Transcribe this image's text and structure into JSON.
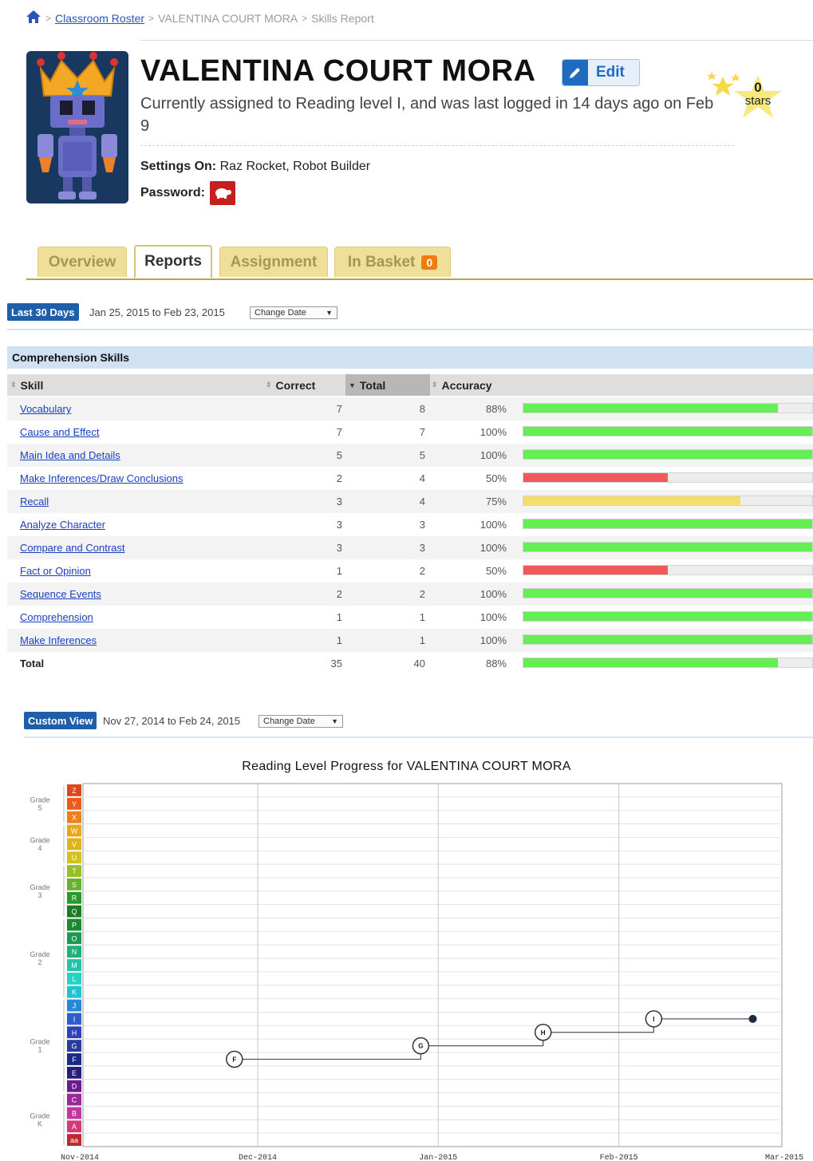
{
  "breadcrumb": {
    "home_icon": "home-icon",
    "items": [
      "Classroom Roster",
      "VALENTINA COURT MORA",
      "Skills Report"
    ],
    "separator": ">"
  },
  "student": {
    "name": "VALENTINA COURT MORA",
    "edit_label": "Edit",
    "status": "Currently assigned to Reading level I, and was last logged in 14 days ago on Feb 9",
    "settings_label": "Settings On:",
    "settings_value": "Raz Rocket, Robot Builder",
    "password_label": "Password:",
    "password_icon": "turtle-icon",
    "stars_count": "0",
    "stars_label": "stars"
  },
  "tabs": [
    {
      "label": "Overview",
      "active": false
    },
    {
      "label": "Reports",
      "active": true
    },
    {
      "label": "Assignment",
      "active": false
    },
    {
      "label": "In Basket",
      "active": false,
      "badge": "0"
    }
  ],
  "skills_range": {
    "badge": "Last 30 Days",
    "dates": "Jan 25, 2015 to Feb 23, 2015",
    "change_label": "Change Date"
  },
  "skills_table": {
    "title": "Comprehension Skills",
    "headers": [
      "Skill",
      "Correct",
      "Total",
      "Accuracy"
    ],
    "sorted_column": "Total",
    "rows": [
      {
        "skill": "Vocabulary",
        "correct": "7",
        "total": "8",
        "accuracy": "88%",
        "pct": 0.88,
        "color": "#66ee55"
      },
      {
        "skill": "Cause and Effect",
        "correct": "7",
        "total": "7",
        "accuracy": "100%",
        "pct": 1.0,
        "color": "#66ee55"
      },
      {
        "skill": "Main Idea and Details",
        "correct": "5",
        "total": "5",
        "accuracy": "100%",
        "pct": 1.0,
        "color": "#66ee55"
      },
      {
        "skill": "Make Inferences/Draw Conclusions",
        "correct": "2",
        "total": "4",
        "accuracy": "50%",
        "pct": 0.5,
        "color": "#f05a5a"
      },
      {
        "skill": "Recall",
        "correct": "3",
        "total": "4",
        "accuracy": "75%",
        "pct": 0.75,
        "color": "#f4dd6a"
      },
      {
        "skill": "Analyze Character",
        "correct": "3",
        "total": "3",
        "accuracy": "100%",
        "pct": 1.0,
        "color": "#66ee55"
      },
      {
        "skill": "Compare and Contrast",
        "correct": "3",
        "total": "3",
        "accuracy": "100%",
        "pct": 1.0,
        "color": "#66ee55"
      },
      {
        "skill": "Fact or Opinion",
        "correct": "1",
        "total": "2",
        "accuracy": "50%",
        "pct": 0.5,
        "color": "#f05a5a"
      },
      {
        "skill": "Sequence Events",
        "correct": "2",
        "total": "2",
        "accuracy": "100%",
        "pct": 1.0,
        "color": "#66ee55"
      },
      {
        "skill": "Comprehension",
        "correct": "1",
        "total": "1",
        "accuracy": "100%",
        "pct": 1.0,
        "color": "#66ee55"
      },
      {
        "skill": "Make Inferences",
        "correct": "1",
        "total": "1",
        "accuracy": "100%",
        "pct": 1.0,
        "color": "#66ee55"
      }
    ],
    "total_row": {
      "skill": "Total",
      "correct": "35",
      "total": "40",
      "accuracy": "88%",
      "pct": 0.88,
      "color": "#66ee55"
    }
  },
  "progress_range": {
    "badge": "Custom View",
    "dates": "Nov 27, 2014 to Feb 24, 2015",
    "change_label": "Change Date"
  },
  "chart_data": {
    "type": "line",
    "title": "Reading Level Progress for VALENTINA COURT MORA",
    "x_ticks": [
      "Nov-2014",
      "Dec-2014",
      "Jan-2015",
      "Feb-2015",
      "Mar-2015"
    ],
    "x_tick_dates": [
      "2014-11-01",
      "2014-12-01",
      "2015-01-01",
      "2015-02-01",
      "2015-03-01"
    ],
    "levels": [
      "aa",
      "A",
      "B",
      "C",
      "D",
      "E",
      "F",
      "G",
      "H",
      "I",
      "J",
      "K",
      "L",
      "M",
      "N",
      "O",
      "P",
      "Q",
      "R",
      "S",
      "T",
      "U",
      "V",
      "W",
      "X",
      "Y",
      "Z"
    ],
    "level_colors": [
      "#c0282e",
      "#d23a7a",
      "#c236a0",
      "#9a2a9a",
      "#6a1a8a",
      "#2a1a7a",
      "#1a2a8a",
      "#2a3aa0",
      "#3040b8",
      "#2f5ecc",
      "#2888d8",
      "#1ec4d0",
      "#26d2c2",
      "#22c4a8",
      "#1cb07a",
      "#1a9a50",
      "#188a30",
      "#1a7a26",
      "#289a2a",
      "#66b22a",
      "#96c028",
      "#d4c020",
      "#e0b21c",
      "#e8a71a",
      "#ee7f1c",
      "#ec5a1c",
      "#e0461e"
    ],
    "grade_groups": [
      {
        "label": "Grade K",
        "from": "aa",
        "to": "C"
      },
      {
        "label": "Grade 1",
        "from": "D",
        "to": "J"
      },
      {
        "label": "Grade 2",
        "from": "K",
        "to": "P"
      },
      {
        "label": "Grade 3",
        "from": "Q",
        "to": "T"
      },
      {
        "label": "Grade 4",
        "from": "U",
        "to": "W"
      },
      {
        "label": "Grade 5",
        "from": "X",
        "to": "Z"
      }
    ],
    "series": [
      {
        "points": [
          {
            "date": "2014-11-27",
            "level": "F"
          },
          {
            "date": "2014-12-29",
            "level": "G"
          },
          {
            "date": "2015-01-19",
            "level": "H"
          },
          {
            "date": "2015-02-07",
            "level": "I"
          },
          {
            "date": "2015-02-24",
            "level": "I"
          }
        ]
      }
    ],
    "grid": true
  }
}
